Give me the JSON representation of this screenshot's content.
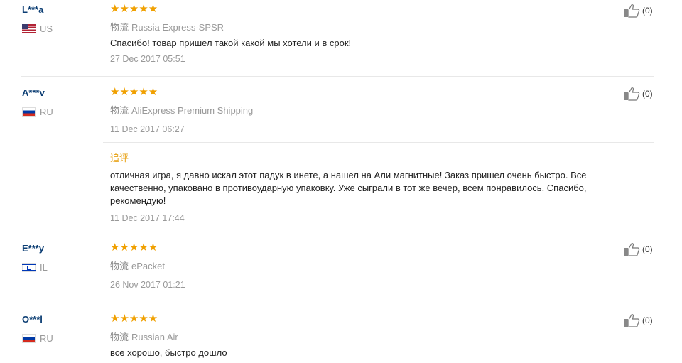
{
  "reviews": [
    {
      "name": "L***a",
      "country": "US",
      "stars": "★★★★★",
      "logistics_label": "物流",
      "logistics": "Russia Express-SPSR",
      "text": "Спасибо! товар пришел такой какой мы хотели и в срок!",
      "date": "27 Dec 2017 05:51",
      "likes": "(0)"
    },
    {
      "name": "A***v",
      "country": "RU",
      "stars": "★★★★★",
      "logistics_label": "物流",
      "logistics": "AliExpress Premium Shipping",
      "date": "11 Dec 2017 06:27",
      "followup_label": "追评",
      "followup_text": "отличная игра, я давно искал этот падук в инете, а нашел на Али магнитные! Заказ пришел очень быстро. Все качественно, упаковано в противоударную упаковку. Уже сыграли в тот же вечер, всем понравилось. Спасибо, рекомендую!",
      "followup_date": "11 Dec 2017 17:44",
      "likes": "(0)"
    },
    {
      "name": "E***y",
      "country": "IL",
      "stars": "★★★★★",
      "logistics_label": "物流",
      "logistics": "ePacket",
      "date": "26 Nov 2017 01:21",
      "likes": "(0)"
    },
    {
      "name": "O***l",
      "country": "RU",
      "stars": "★★★★★",
      "logistics_label": "物流",
      "logistics": "Russian Air",
      "text": "все хорошо, быстро дошло",
      "likes": "(0)"
    }
  ],
  "colors": {
    "star": "#f0a000",
    "name": "#0b3d73",
    "followup": "#e8a317"
  },
  "icons": {
    "like": "thumbs-up-icon"
  }
}
